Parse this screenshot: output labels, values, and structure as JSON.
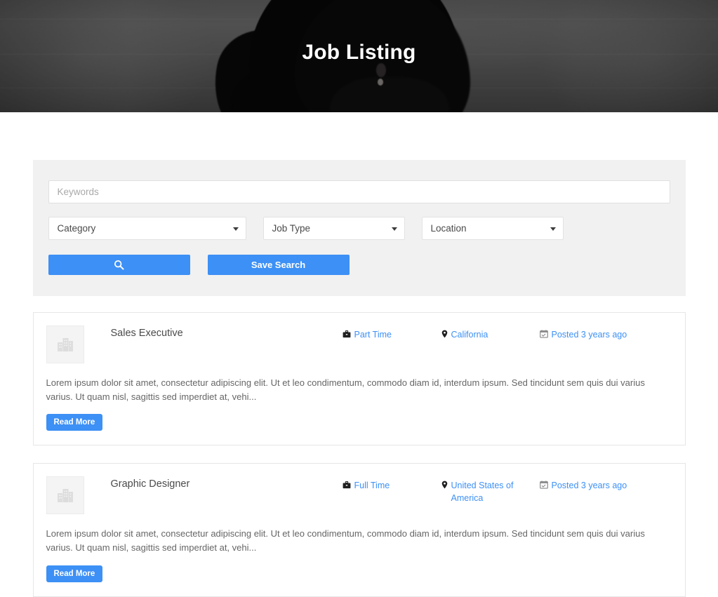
{
  "hero": {
    "title": "Job Listing"
  },
  "search": {
    "keywords_placeholder": "Keywords",
    "keywords_value": "",
    "category_label": "Category",
    "jobtype_label": "Job Type",
    "location_label": "Location",
    "search_button_label": "",
    "search_icon": "search-icon",
    "save_button_label": "Save Search"
  },
  "jobs": [
    {
      "title": "Sales Executive",
      "thumb_icon": "image-placeholder-buildings-icon",
      "job_type": "Part Time",
      "job_type_icon": "briefcase-icon",
      "location": "California",
      "location_icon": "map-marker-icon",
      "posted": "Posted 3 years ago",
      "posted_icon": "calendar-check-icon",
      "description": "Lorem ipsum dolor sit amet, consectetur adipiscing elit. Ut et leo condimentum, commodo diam id, interdum ipsum. Sed tincidunt sem quis dui varius varius. Ut quam nisl, sagittis sed imperdiet at, vehi...",
      "read_more_label": "Read More"
    },
    {
      "title": "Graphic Designer",
      "thumb_icon": "image-placeholder-buildings-icon",
      "job_type": "Full Time",
      "job_type_icon": "briefcase-icon",
      "location": "United States of America",
      "location_icon": "map-marker-icon",
      "posted": "Posted 3 years ago",
      "posted_icon": "calendar-check-icon",
      "description": "Lorem ipsum dolor sit amet, consectetur adipiscing elit. Ut et leo condimentum, commodo diam id, interdum ipsum. Sed tincidunt sem quis dui varius varius. Ut quam nisl, sagittis sed imperdiet at, vehi...",
      "read_more_label": "Read More"
    }
  ],
  "colors": {
    "accent_blue": "#3d90f5",
    "panel_gray": "#f1f1f1",
    "card_border": "#e6e6e6",
    "text_dark": "#4a4a4a",
    "text_muted": "#666666"
  }
}
